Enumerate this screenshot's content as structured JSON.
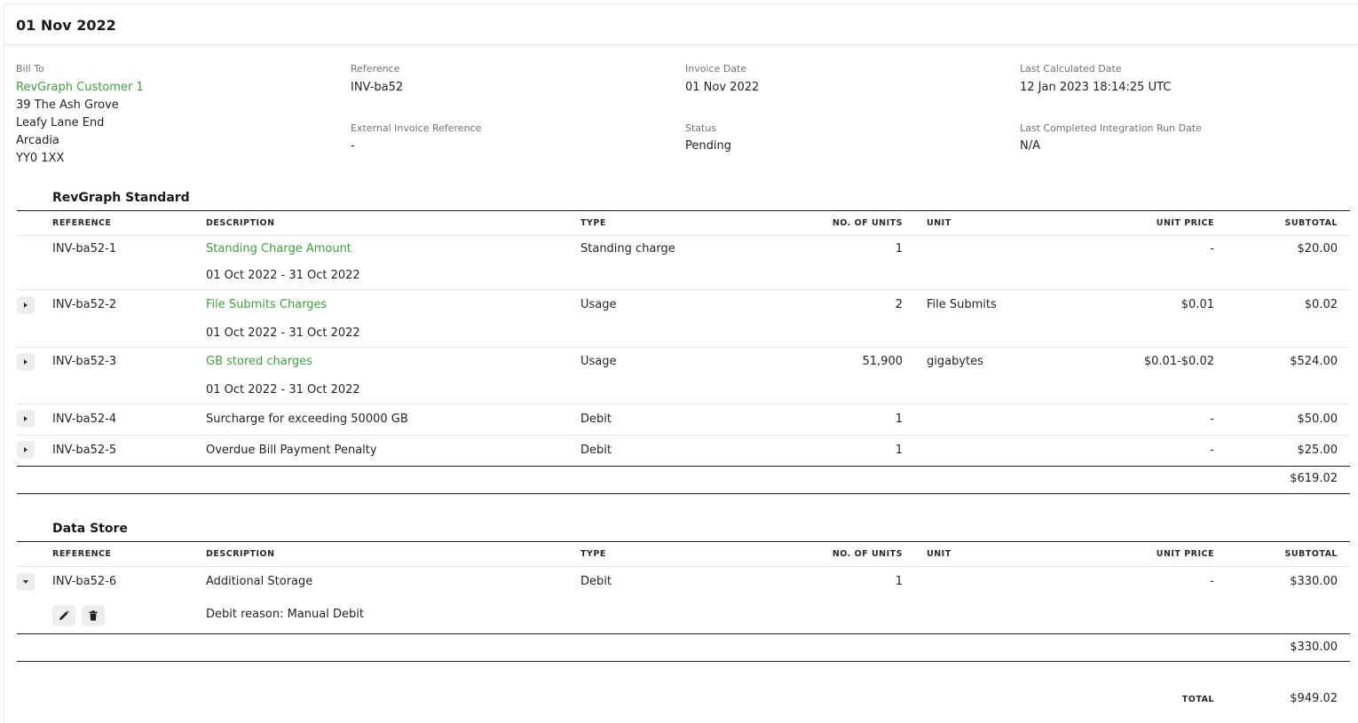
{
  "invoice": {
    "title": "01 Nov 2022",
    "bill_to_label": "Bill To",
    "customer_name": "RevGraph Customer 1",
    "address": [
      "39 The Ash Grove",
      "Leafy Lane End",
      "Arcadia",
      "YY0 1XX"
    ],
    "reference_label": "Reference",
    "reference": "INV-ba52",
    "external_ref_label": "External Invoice Reference",
    "external_ref": "-",
    "invoice_date_label": "Invoice Date",
    "invoice_date": "01 Nov 2022",
    "status_label": "Status",
    "status": "Pending",
    "last_calc_label": "Last Calculated Date",
    "last_calc": "12 Jan 2023 18:14:25 UTC",
    "last_integration_label": "Last Completed Integration Run Date",
    "last_integration": "N/A"
  },
  "columns": {
    "reference": "REFERENCE",
    "description": "DESCRIPTION",
    "type": "TYPE",
    "units": "NO. OF UNITS",
    "unit": "UNIT",
    "unit_price": "UNIT PRICE",
    "subtotal": "SUBTOTAL"
  },
  "sections": [
    {
      "title": "RevGraph Standard",
      "rows": [
        {
          "reference": "INV-ba52-1",
          "description": "Standing Charge Amount",
          "period": "01 Oct 2022 - 31 Oct 2022",
          "type": "Standing charge",
          "units": "1",
          "unit": "",
          "unit_price": "-",
          "subtotal": "$20.00"
        },
        {
          "reference": "INV-ba52-2",
          "description": "File Submits Charges",
          "period": "01 Oct 2022 - 31 Oct 2022",
          "type": "Usage",
          "units": "2",
          "unit": "File Submits",
          "unit_price": "$0.01",
          "subtotal": "$0.02"
        },
        {
          "reference": "INV-ba52-3",
          "description": "GB stored charges",
          "period": "01 Oct 2022 - 31 Oct 2022",
          "type": "Usage",
          "units": "51,900",
          "unit": "gigabytes",
          "unit_price": "$0.01-$0.02",
          "subtotal": "$524.00"
        },
        {
          "reference": "INV-ba52-4",
          "description": "Surcharge for exceeding 50000 GB",
          "type": "Debit",
          "units": "1",
          "unit": "",
          "unit_price": "-",
          "subtotal": "$50.00"
        },
        {
          "reference": "INV-ba52-5",
          "description": "Overdue Bill Payment Penalty",
          "type": "Debit",
          "units": "1",
          "unit": "",
          "unit_price": "-",
          "subtotal": "$25.00"
        }
      ],
      "section_total": "$619.02"
    },
    {
      "title": "Data Store",
      "rows": [
        {
          "reference": "INV-ba52-6",
          "description": "Additional Storage",
          "detail": "Debit reason: Manual Debit",
          "type": "Debit",
          "units": "1",
          "unit": "",
          "unit_price": "-",
          "subtotal": "$330.00"
        }
      ],
      "section_total": "$330.00"
    }
  ],
  "total_label": "TOTAL",
  "total": "$949.02",
  "icons": {
    "expand": "caret-right-icon",
    "collapse": "caret-down-icon",
    "edit": "pencil-icon",
    "delete": "trash-icon"
  },
  "colors": {
    "link_green": "#3ea040",
    "button_bg": "#eceef0"
  }
}
